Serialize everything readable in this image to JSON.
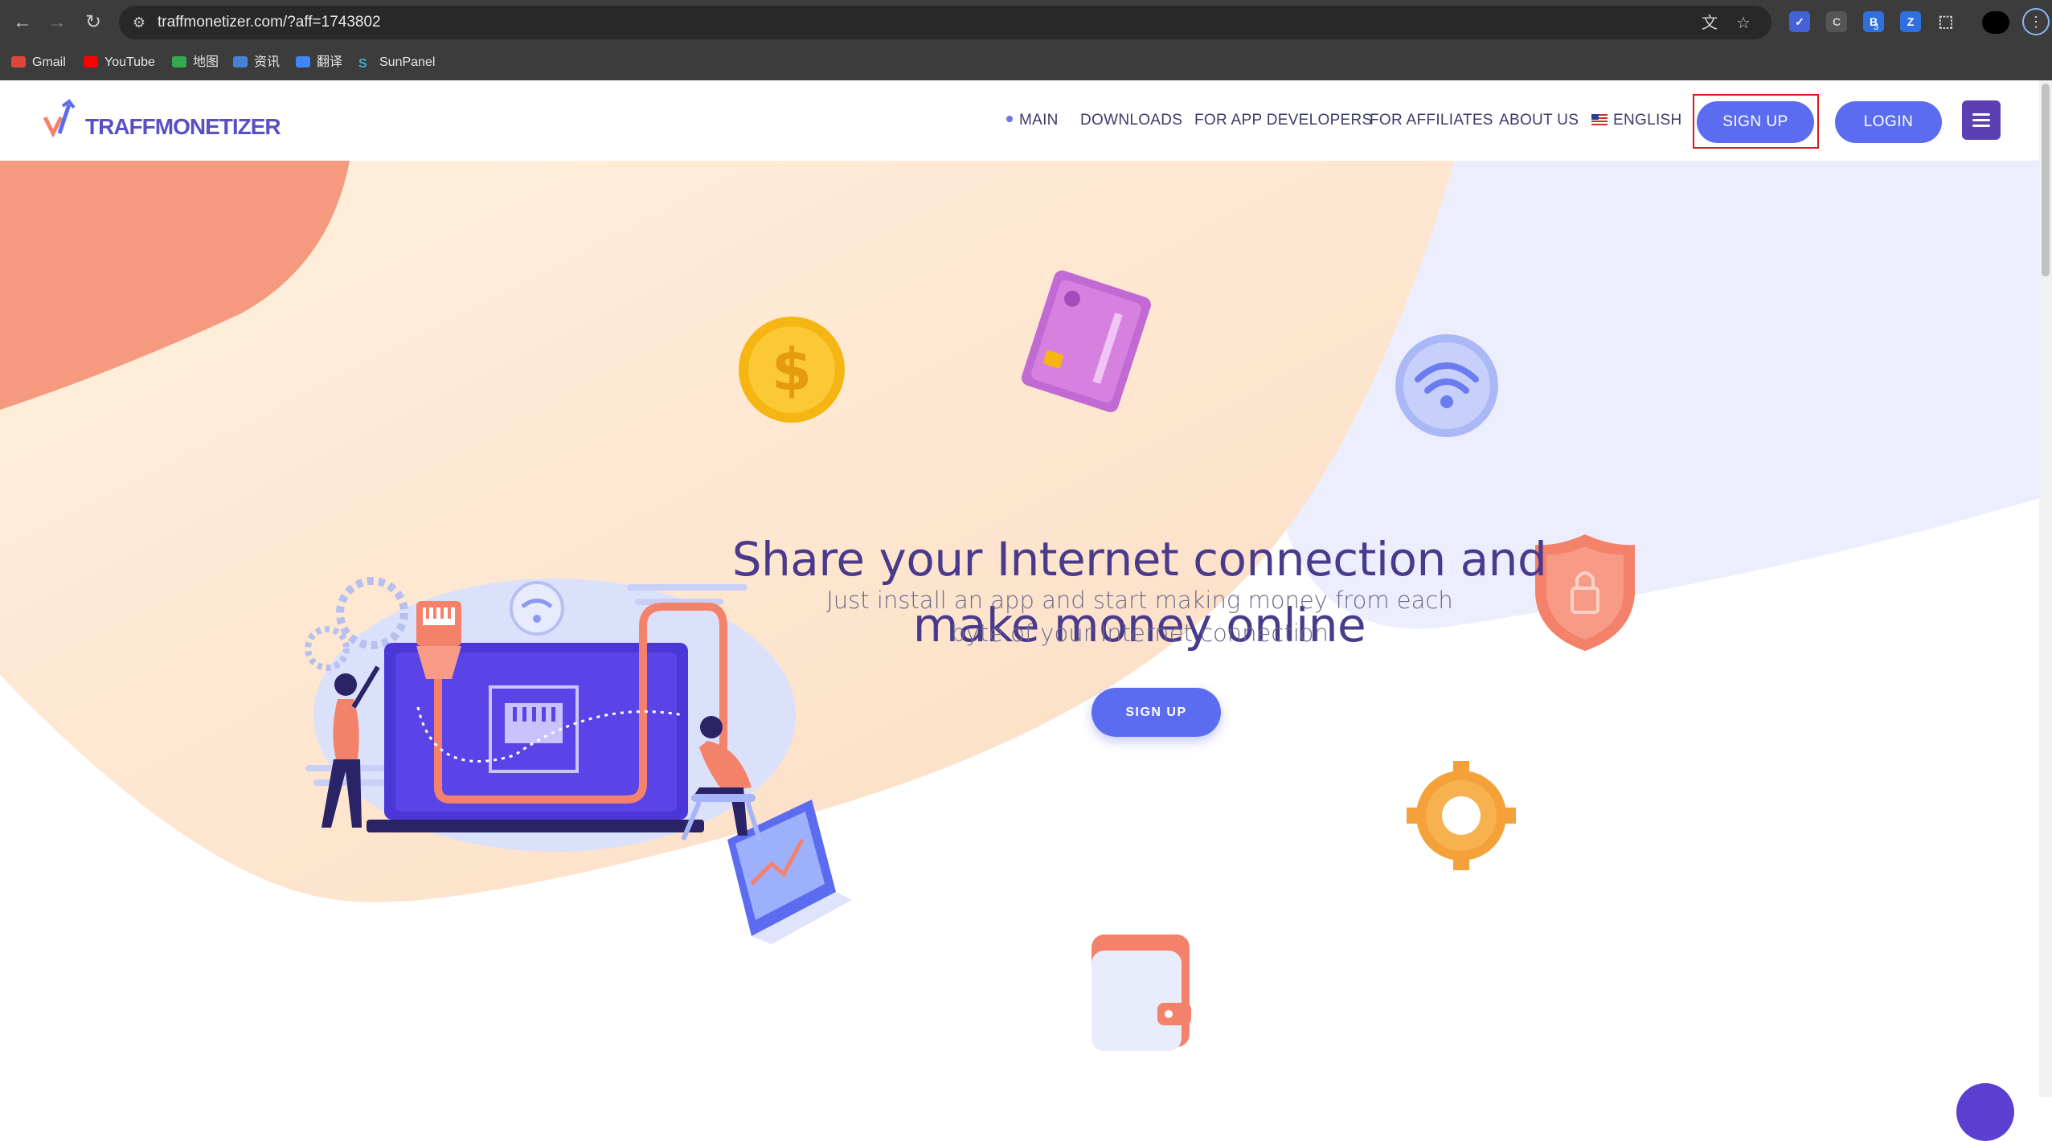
{
  "browser": {
    "url": "traffmonetizer.com/?aff=1743802",
    "bookmarks": [
      "Gmail",
      "YouTube",
      "地图",
      "资讯",
      "翻译",
      "SunPanel"
    ],
    "ext_badge": "3"
  },
  "header": {
    "logo_text": "TRAFFMONETIZER",
    "nav": [
      "MAIN",
      "DOWNLOADS",
      "FOR APP DEVELOPERS",
      "FOR AFFILIATES",
      "ABOUT US"
    ],
    "language": "ENGLISH",
    "signup_label": "SIGN UP",
    "login_label": "LOGIN"
  },
  "hero": {
    "title_line1": "Share your Internet connection and",
    "title_line2": "make money online",
    "subtitle_line1": "Just install an app and start making money from each",
    "subtitle_line2": "byte of your Internet connection",
    "cta_label": "SIGN UP"
  },
  "colors": {
    "accent": "#5b6cf0",
    "brand_purple": "#4a3a8c",
    "coral": "#f4826b",
    "peach": "#fde2c9",
    "lavender": "#e8ebfd",
    "highlight": "#e0141e"
  }
}
